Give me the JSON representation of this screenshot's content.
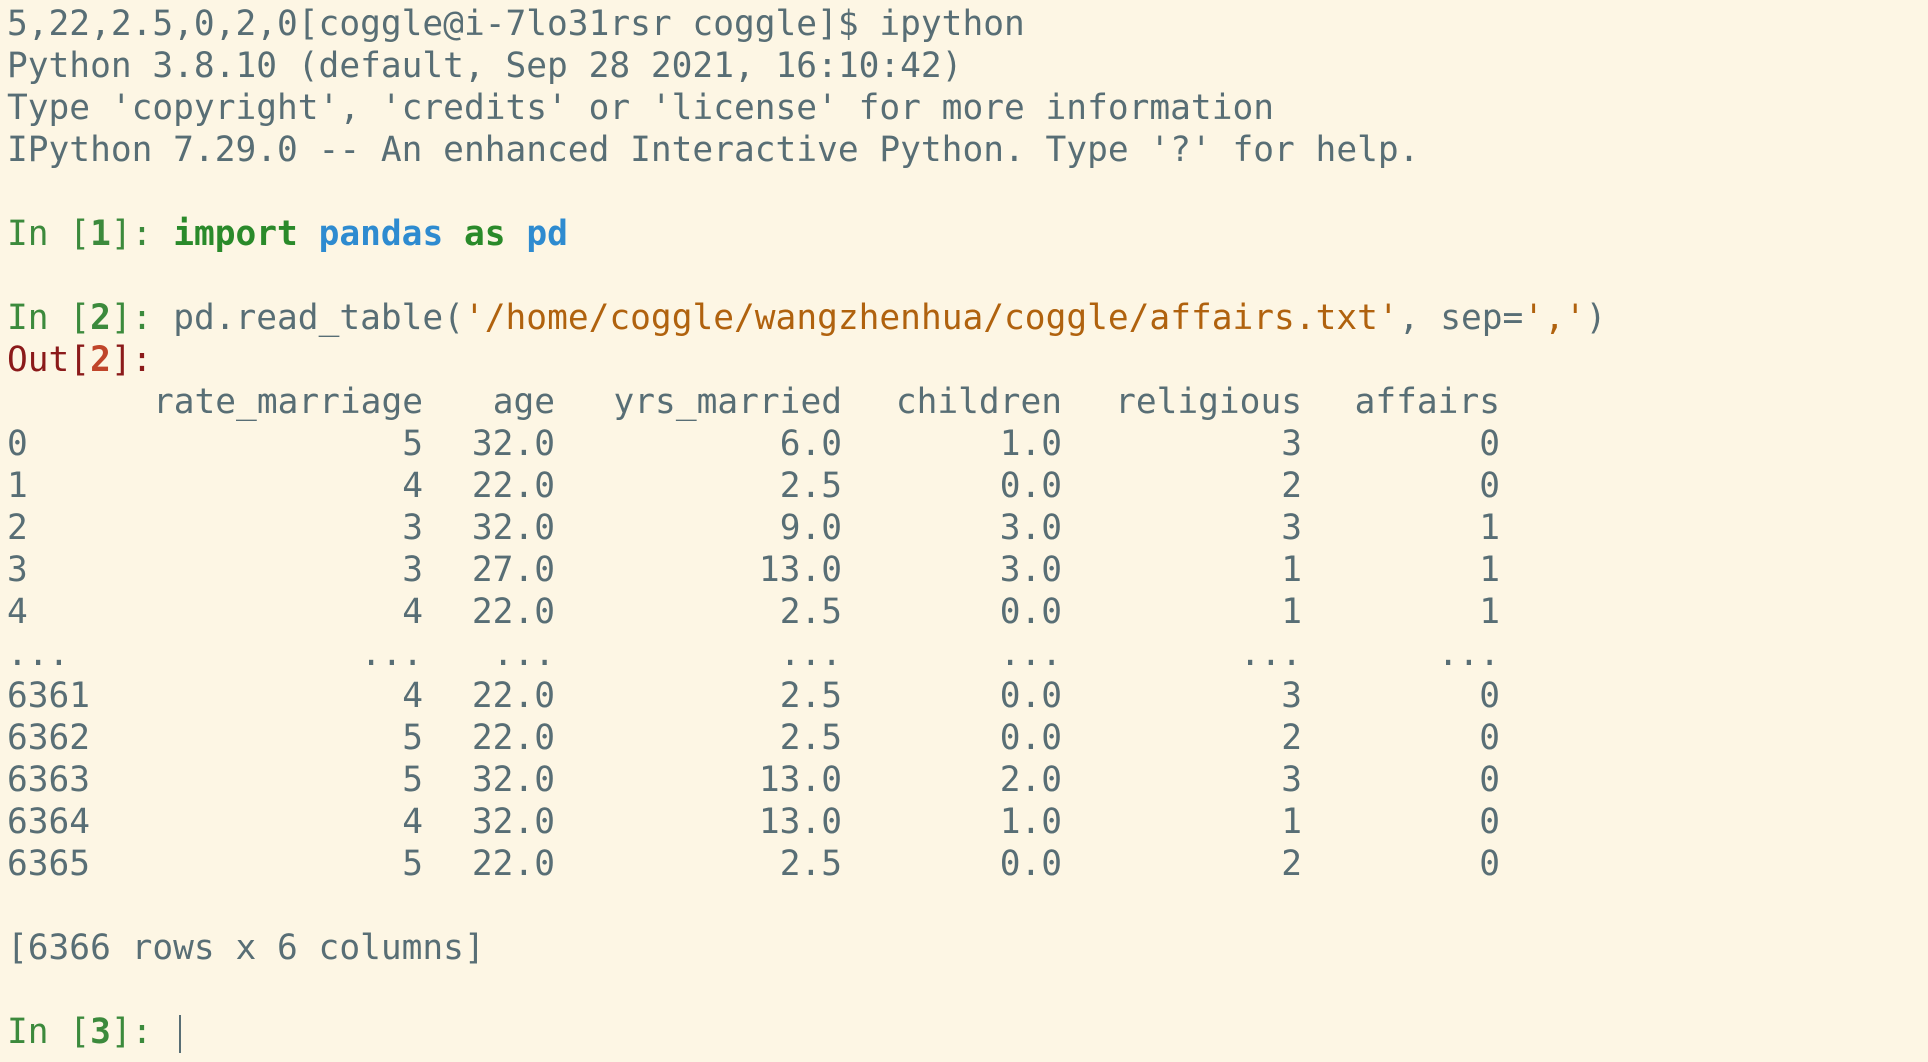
{
  "terminal": {
    "top_line": "5,22,2.5,0,2,0[coggle@i-7lo31rsr coggle]$ ipython",
    "banner_1": "Python 3.8.10 (default, Sep 28 2021, 16:10:42)",
    "banner_2": "Type 'copyright', 'credits' or 'license' for more information",
    "banner_3": "IPython 7.29.0 -- An enhanced Interactive Python. Type '?' for help."
  },
  "cell1": {
    "in_label": "In [",
    "num": "1",
    "close": "]: ",
    "kw_import": "import",
    "module": "pandas",
    "kw_as": "as",
    "alias": "pd"
  },
  "cell2": {
    "in_label": "In [",
    "num": "2",
    "close": "]: ",
    "code_prefix": "pd.read_table(",
    "path_str": "'/home/coggle/wangzhenhua/coggle/affairs.txt'",
    "code_mid": ", sep=",
    "sep_str": "','",
    "code_end": ")",
    "out_label": "Out[",
    "out_num": "2",
    "out_close": "]:"
  },
  "dataframe": {
    "columns": [
      "rate_marriage",
      "age",
      "yrs_married",
      "children",
      "religious",
      "affairs"
    ],
    "rows": [
      {
        "index": "0",
        "values": [
          "5",
          "32.0",
          "6.0",
          "1.0",
          "3",
          "0"
        ]
      },
      {
        "index": "1",
        "values": [
          "4",
          "22.0",
          "2.5",
          "0.0",
          "2",
          "0"
        ]
      },
      {
        "index": "2",
        "values": [
          "3",
          "32.0",
          "9.0",
          "3.0",
          "3",
          "1"
        ]
      },
      {
        "index": "3",
        "values": [
          "3",
          "27.0",
          "13.0",
          "3.0",
          "1",
          "1"
        ]
      },
      {
        "index": "4",
        "values": [
          "4",
          "22.0",
          "2.5",
          "0.0",
          "1",
          "1"
        ]
      },
      {
        "index": "...",
        "values": [
          "...",
          "...",
          "...",
          "...",
          "...",
          "..."
        ]
      },
      {
        "index": "6361",
        "values": [
          "4",
          "22.0",
          "2.5",
          "0.0",
          "3",
          "0"
        ]
      },
      {
        "index": "6362",
        "values": [
          "5",
          "22.0",
          "2.5",
          "0.0",
          "2",
          "0"
        ]
      },
      {
        "index": "6363",
        "values": [
          "5",
          "32.0",
          "13.0",
          "2.0",
          "3",
          "0"
        ]
      },
      {
        "index": "6364",
        "values": [
          "4",
          "32.0",
          "13.0",
          "1.0",
          "1",
          "0"
        ]
      },
      {
        "index": "6365",
        "values": [
          "5",
          "22.0",
          "2.5",
          "0.0",
          "2",
          "0"
        ]
      }
    ],
    "summary": "[6366 rows x 6 columns]"
  },
  "cell3": {
    "in_label": "In [",
    "num": "3",
    "close": "]: "
  },
  "colors": {
    "background": "#fdf6e4",
    "text": "#586e75",
    "prompt": "#3c8a3c",
    "out_prompt": "#8b1a1a",
    "keyword": "#2a8a2a",
    "module": "#2e8bd0",
    "string": "#b0620e"
  }
}
